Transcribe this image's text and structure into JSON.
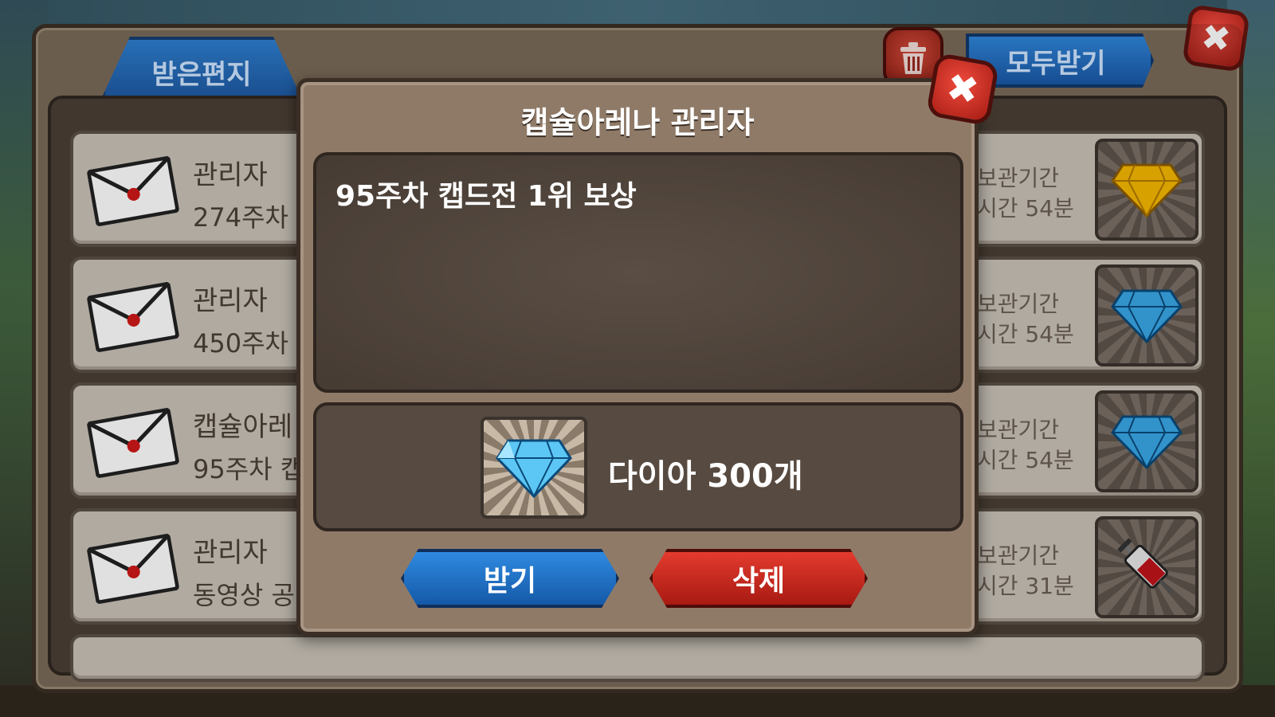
{
  "mailbox": {
    "tab_label": "받은편지",
    "receive_all_label": "모두받기",
    "rows": [
      {
        "sender": "관리자",
        "subject": "274주차",
        "meta1": "보관기간",
        "meta2": "시간 54분",
        "reward_icon": "gold-diamond-icon"
      },
      {
        "sender": "관리자",
        "subject": "450주차",
        "meta1": "보관기간",
        "meta2": "시간 54분",
        "reward_icon": "blue-diamond-icon"
      },
      {
        "sender": "캡슐아레",
        "subject": "95주차 캡",
        "meta1": "보관기간",
        "meta2": "시간 54분",
        "reward_icon": "blue-diamond-icon"
      },
      {
        "sender": "관리자",
        "subject": "동영상 공",
        "meta1": "보관기간",
        "meta2": "시간 31분",
        "reward_icon": "syringe-icon"
      }
    ]
  },
  "dialog": {
    "title": "캡슐아레나 관리자",
    "message": "95주차 캡드전 1위 보상",
    "reward_label": "다이아 300개",
    "reward_icon": "diamond-icon",
    "receive_label": "받기",
    "delete_label": "삭제"
  },
  "colors": {
    "blue_button": "#1f6cc2",
    "red_button": "#c8271c",
    "panel_brown": "#8f7a68"
  }
}
